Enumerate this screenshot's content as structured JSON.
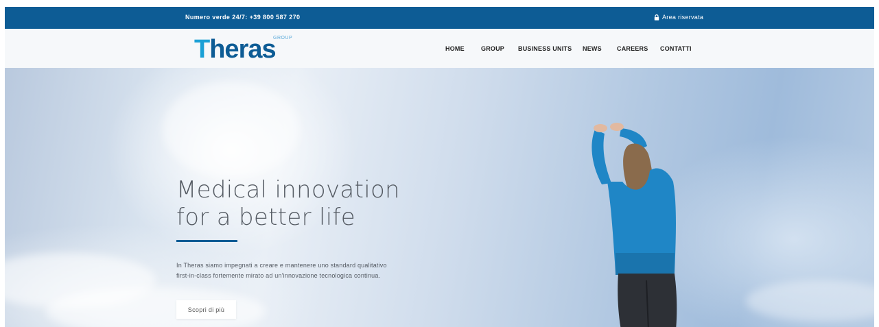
{
  "topbar": {
    "phone": "Numero verde 24/7: +39 800 587 270",
    "reserved_area": "Area riservata"
  },
  "header": {
    "logo_text": "Theras",
    "logo_group": "GROUP",
    "nav": [
      "HOME",
      "GROUP",
      "BUSINESS UNITS",
      "NEWS",
      "CAREERS",
      "CONTATTI"
    ]
  },
  "hero": {
    "title_line1": "Medical innovation",
    "title_line2": "for a better life",
    "text_line1": "In Theras siamo impegnati a creare e mantenere uno standard qualitativo",
    "text_line2": "first-in-class fortemente mirato ad un'innovazione tecnologica continua.",
    "button_label": "Scopri di più"
  },
  "colors": {
    "brand_blue": "#0d5c95",
    "logo_accent": "#1aa0d6",
    "jacket_blue": "#1f86c6"
  },
  "icons": {
    "reserved_area": "lock-icon"
  }
}
